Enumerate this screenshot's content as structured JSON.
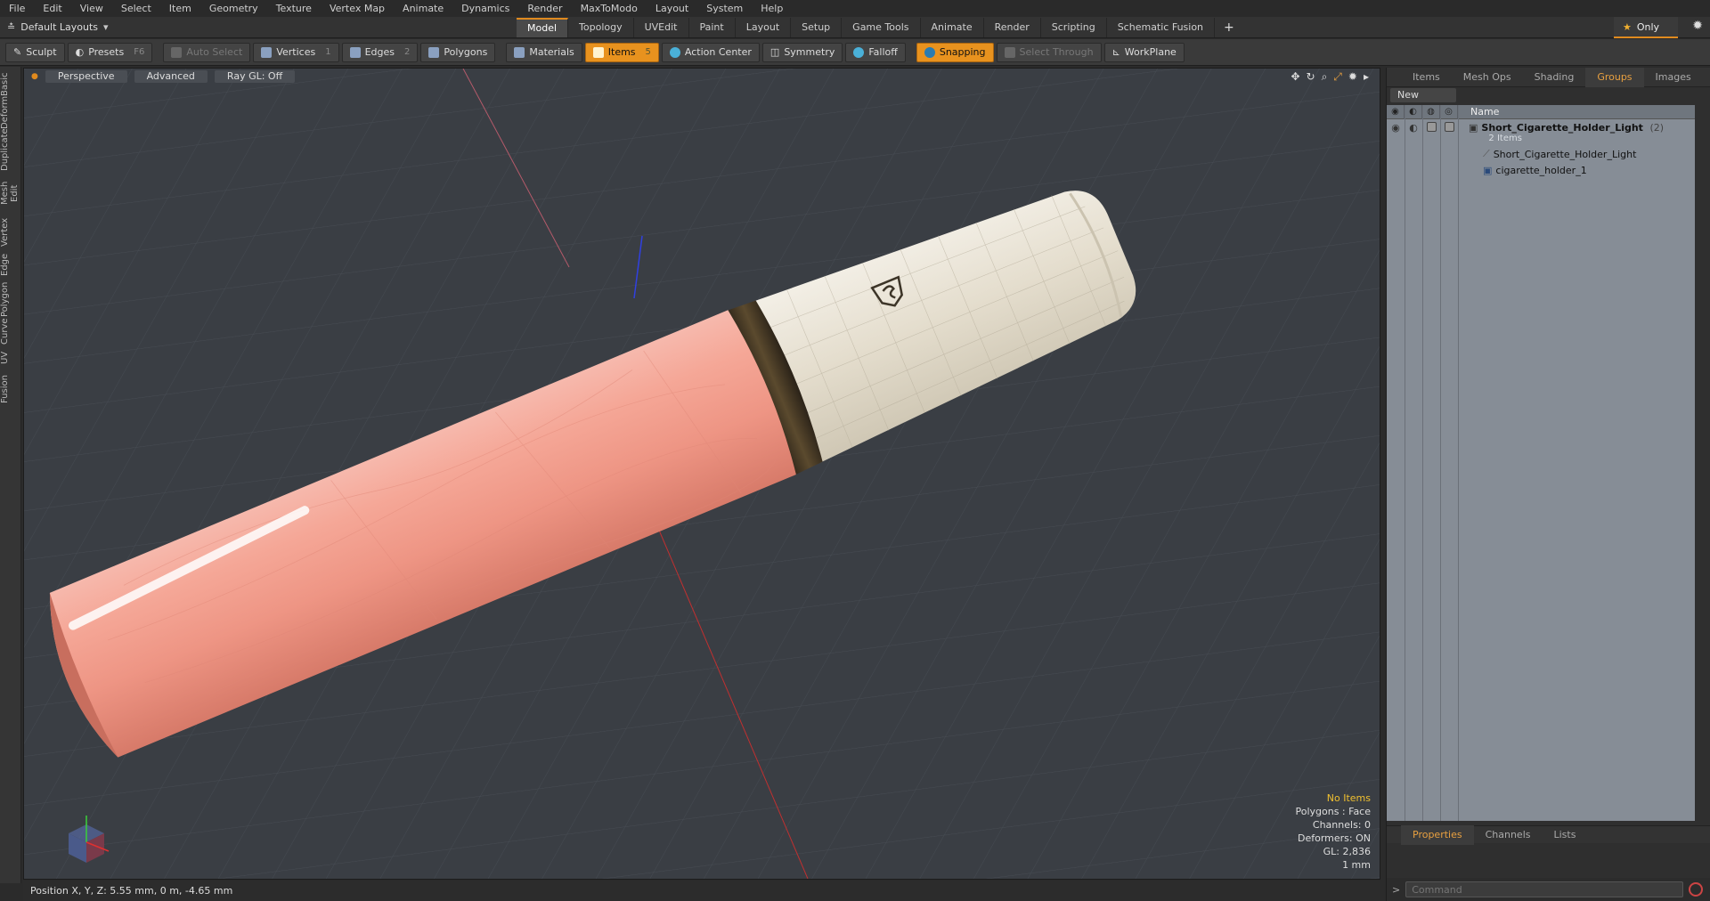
{
  "menu": [
    "File",
    "Edit",
    "View",
    "Select",
    "Item",
    "Geometry",
    "Texture",
    "Vertex Map",
    "Animate",
    "Dynamics",
    "Render",
    "MaxToModo",
    "Layout",
    "System",
    "Help"
  ],
  "layout_selector": "Default Layouts",
  "mode_tabs": [
    "Model",
    "Topology",
    "UVEdit",
    "Paint",
    "Layout",
    "Setup",
    "Game Tools",
    "Animate",
    "Render",
    "Scripting",
    "Schematic Fusion"
  ],
  "active_mode_tab": "Model",
  "only_label": "Only",
  "toolbar": {
    "sculpt": "Sculpt",
    "presets": "Presets",
    "presets_key": "F6",
    "auto_select": "Auto Select",
    "vertices": "Vertices",
    "vertices_key": "1",
    "edges": "Edges",
    "edges_key": "2",
    "polygons": "Polygons",
    "materials": "Materials",
    "items": "Items",
    "items_key": "5",
    "action_center": "Action Center",
    "symmetry": "Symmetry",
    "falloff": "Falloff",
    "snapping": "Snapping",
    "select_through": "Select Through",
    "workplane": "WorkPlane"
  },
  "left_tabs": [
    "Basic",
    "Deform",
    "Duplicate",
    "Mesh Edit",
    "Vertex",
    "Edge",
    "Polygon",
    "Curve",
    "UV",
    "Fusion"
  ],
  "viewport": {
    "view_mode": "Perspective",
    "shading": "Advanced",
    "raygl": "Ray GL: Off",
    "stats": {
      "selection": "No Items",
      "polygons": "Polygons : Face",
      "channels": "Channels: 0",
      "deformers": "Deformers: ON",
      "gl": "GL: 2,836",
      "unit": "1 mm"
    }
  },
  "status_bar": "Position X, Y, Z:   5.55 mm, 0 m, -4.65 mm",
  "right_panel": {
    "tabs": [
      "Items",
      "Mesh Ops",
      "Shading",
      "Groups",
      "Images"
    ],
    "active_tab": "Groups",
    "new_group": "New Group",
    "column_name": "Name",
    "group": {
      "name": "Short_Cigarette_Holder_Light",
      "count": "(2)",
      "items_label": "2 Items",
      "children": [
        "Short_Cigarette_Holder_Light",
        "cigarette_holder_1"
      ]
    },
    "bottom_tabs": [
      "Properties",
      "Channels",
      "Lists"
    ],
    "active_bottom_tab": "Properties",
    "command_placeholder": "Command"
  },
  "colors": {
    "accent": "#e8921e",
    "filter_body": "#f2a495",
    "mouthpiece": "#e6e0d2",
    "band": "#3a2f1e"
  }
}
